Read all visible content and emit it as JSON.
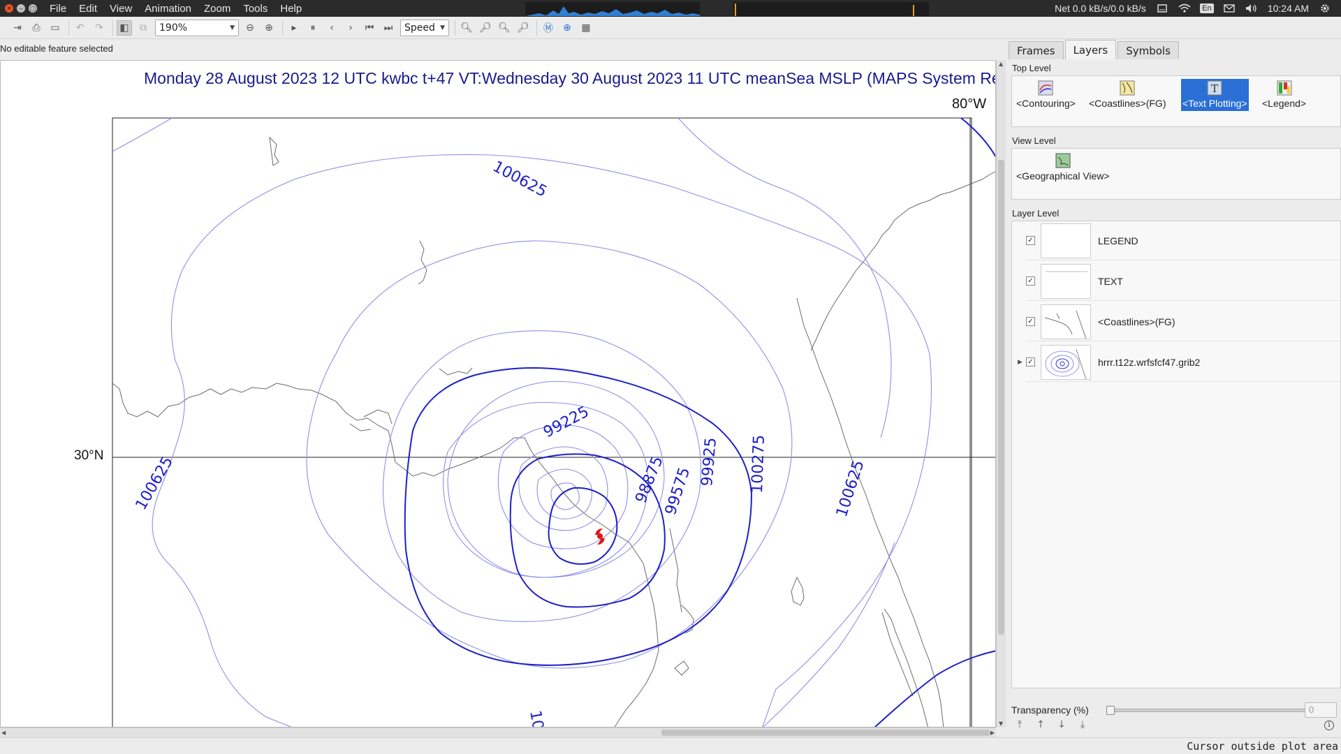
{
  "menu": [
    "File",
    "Edit",
    "View",
    "Animation",
    "Zoom",
    "Tools",
    "Help"
  ],
  "tray": {
    "net": "Net 0.0 kB/s/0.0 kB/s",
    "lang": "En",
    "time": "10:24 AM"
  },
  "toolbar": {
    "zoom": "190%",
    "speed": "Speed"
  },
  "status_top": "No editable feature selected",
  "plot": {
    "title": "Monday 28 August 2023 12 UTC kwbc t+47 VT:Wednesday 30 August 2023 11 UTC meanSea  MSLP (MAPS System Re",
    "lon_label": "80°W",
    "lat_label": "30°N",
    "contour_labels": [
      "100625",
      "100625",
      "100625",
      "99225",
      "98875",
      "99575",
      "99925",
      "100275",
      "10"
    ],
    "colors": {
      "major": "#1f1fc8",
      "minor": "#8f8fe8",
      "coast": "#6a6a6a",
      "title": "#1a1a8c",
      "storm": "#e01818"
    }
  },
  "tabs": [
    "Frames",
    "Layers",
    "Symbols"
  ],
  "active_tab": "Layers",
  "top_level": {
    "label": "Top Level",
    "items": [
      "<Contouring>",
      "<Coastlines>(FG)",
      "<Text Plotting>",
      "<Legend>"
    ],
    "selected": "<Text Plotting>"
  },
  "view_level": {
    "label": "View Level",
    "items": [
      "<Geographical View>"
    ]
  },
  "layer_level": {
    "label": "Layer Level",
    "layers": [
      {
        "name": "LEGEND",
        "checked": true
      },
      {
        "name": "TEXT",
        "checked": true
      },
      {
        "name": "<Coastlines>(FG)",
        "checked": true
      },
      {
        "name": "hrrr.t12z.wrfsfcf47.grib2",
        "checked": true
      }
    ]
  },
  "transparency": {
    "label": "Transparency (%)",
    "value": "0"
  },
  "cursor_status": "Cursor outside plot area"
}
